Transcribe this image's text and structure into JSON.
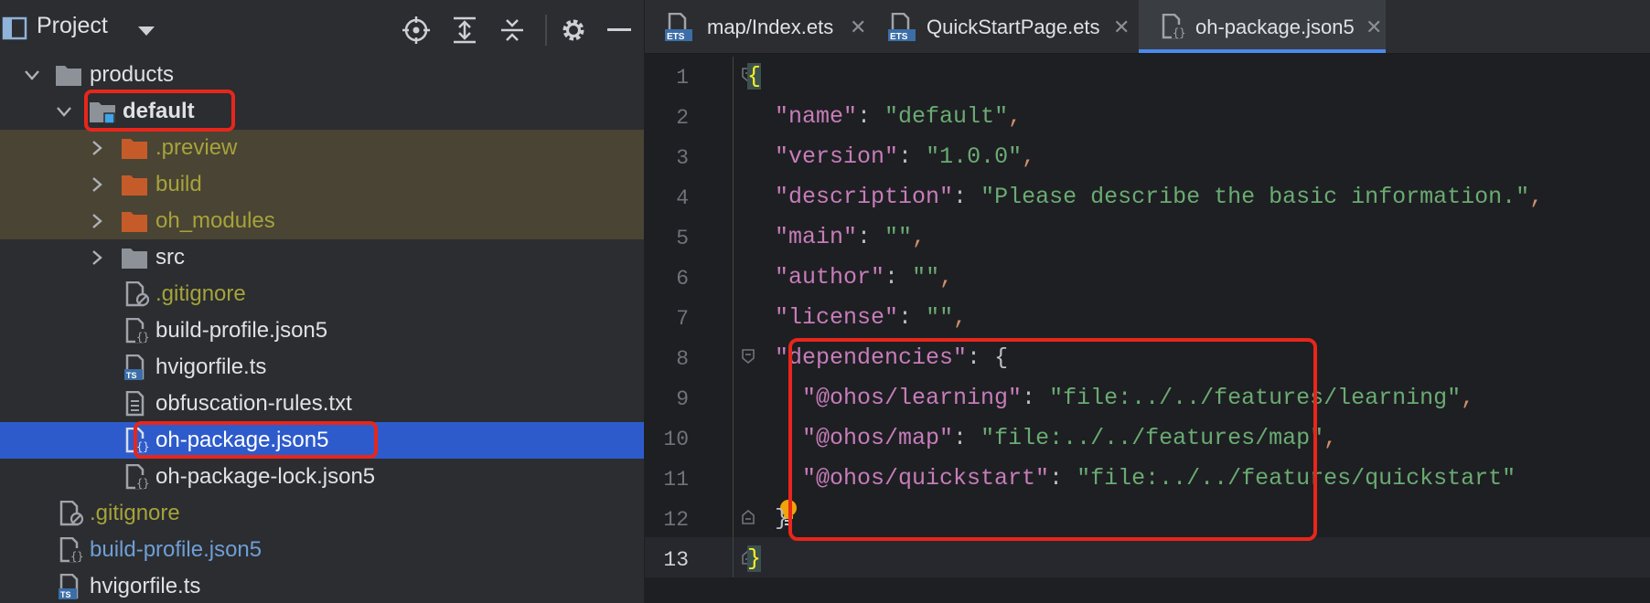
{
  "project_panel": {
    "title": "Project",
    "toolbar_icons": [
      "project-window-icon",
      "dropdown-arrow-icon",
      "locate-file-icon",
      "expand-all-icon",
      "collapse-all-icon",
      "settings-gear-icon",
      "minimize-icon"
    ]
  },
  "tree": [
    {
      "label": "products",
      "type": "folder",
      "expanded": true
    },
    {
      "label": "default",
      "type": "module-folder",
      "expanded": true,
      "highlighted": true
    },
    {
      "label": ".preview",
      "type": "excluded-folder",
      "expanded": false
    },
    {
      "label": "build",
      "type": "excluded-folder",
      "expanded": false
    },
    {
      "label": "oh_modules",
      "type": "excluded-folder",
      "expanded": false
    },
    {
      "label": "src",
      "type": "folder",
      "expanded": false
    },
    {
      "label": ".gitignore",
      "type": "ignored-file"
    },
    {
      "label": "build-profile.json5",
      "type": "json5-file"
    },
    {
      "label": "hvigorfile.ts",
      "type": "ts-file"
    },
    {
      "label": "obfuscation-rules.txt",
      "type": "text-file"
    },
    {
      "label": "oh-package.json5",
      "type": "json5-file",
      "selected": true,
      "highlighted": true
    },
    {
      "label": "oh-package-lock.json5",
      "type": "json5-file"
    },
    {
      "label": ".gitignore",
      "type": "ignored-file"
    },
    {
      "label": "build-profile.json5",
      "type": "json5-file"
    },
    {
      "label": "hvigorfile.ts",
      "type": "ts-file"
    }
  ],
  "tabs": [
    {
      "label": "map/Index.ets",
      "icon": "ets-file-icon",
      "active": false
    },
    {
      "label": "QuickStartPage.ets",
      "icon": "ets-file-icon",
      "active": false
    },
    {
      "label": "oh-package.json5",
      "icon": "json5-file-icon",
      "active": true
    }
  ],
  "tab_close": "✕",
  "line_numbers": [
    "1",
    "2",
    "3",
    "4",
    "5",
    "6",
    "7",
    "8",
    "9",
    "10",
    "11",
    "12",
    "13"
  ],
  "code": {
    "l1": {
      "brace": "{"
    },
    "l2": {
      "key": "\"name\"",
      "value": "\"default\""
    },
    "l3": {
      "key": "\"version\"",
      "value": "\"1.0.0\""
    },
    "l4": {
      "key": "\"description\"",
      "value": "\"Please describe the basic information.\""
    },
    "l5": {
      "key": "\"main\"",
      "value": "\"\""
    },
    "l6": {
      "key": "\"author\"",
      "value": "\"\""
    },
    "l7": {
      "key": "\"license\"",
      "value": "\"\""
    },
    "l8": {
      "key": "\"dependencies\"",
      "brace": "{"
    },
    "l9": {
      "key": "\"@ohos/learning\"",
      "value": "\"file:../../features/learning\""
    },
    "l10": {
      "key": "\"@ohos/map\"",
      "value": "\"file:../../features/map\""
    },
    "l11": {
      "key": "\"@ohos/quickstart\"",
      "value": "\"file:../../features/quickstart\""
    },
    "l12": {
      "brace": "}"
    },
    "l13": {
      "brace": "}"
    }
  },
  "punct": {
    "colon": ":",
    "comma": ","
  },
  "colors": {
    "highlight_border": "#e8261b",
    "selection": "#2e5bcc",
    "string": "#6aab73",
    "key": "#c77dbb"
  }
}
